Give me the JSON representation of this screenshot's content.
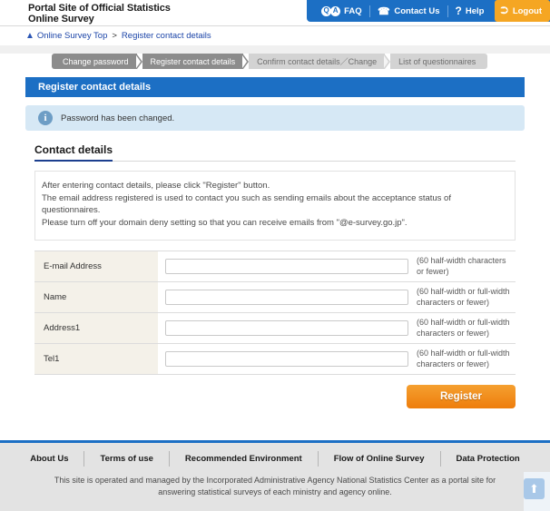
{
  "header": {
    "site_title_line1": "Portal Site of Official Statistics",
    "site_title_line2": "Online Survey",
    "nav": {
      "faq": "FAQ",
      "faq_icon_q": "Q",
      "faq_icon_a": "A",
      "contact": "Contact Us",
      "contact_icon": "phone-icon",
      "help": "Help",
      "help_icon": "?",
      "logout": "Logout",
      "logout_icon": "exit-icon"
    },
    "nav_bg_color": "#1c6fc4",
    "logout_bg_color": "#f5a623"
  },
  "breadcrumb": {
    "home_icon": "home-icon",
    "home": "Online Survey Top",
    "separator": ">",
    "current": "Register contact details"
  },
  "steps": [
    {
      "label": "Change password",
      "state": "done"
    },
    {
      "label": "Register contact details",
      "state": "current"
    },
    {
      "label": "Confirm contact details／Change",
      "state": "upcoming"
    },
    {
      "label": "List of questionnaires",
      "state": "upcoming"
    }
  ],
  "page_title": "Register contact details",
  "page_title_bg": "#1c6fc4",
  "info_message": {
    "icon": "info-icon",
    "text": "Password has been changed."
  },
  "section": {
    "heading": "Contact details",
    "underline_color": "#1c3f8f"
  },
  "notice_lines": [
    "After entering contact details, please click \"Register\" button.",
    "The email address registered is used to contact you such as sending emails about the acceptance status of questionnaires.",
    "Please turn off your domain deny setting so that you can receive emails from \"@e-survey.go.jp\"."
  ],
  "form_rows": [
    {
      "label": "E-mail Address",
      "value": "",
      "placeholder": "",
      "note": "(60 half-width characters or fewer)"
    },
    {
      "label": "Name",
      "value": "",
      "placeholder": "",
      "note": "(60 half-width or full-width characters or fewer)"
    },
    {
      "label": "Address1",
      "value": "",
      "placeholder": "",
      "note": "(60 half-width or full-width characters or fewer)"
    },
    {
      "label": "Tel1",
      "value": "",
      "placeholder": "",
      "note": "(60 half-width or full-width characters or fewer)"
    }
  ],
  "submit": {
    "label": "Register",
    "color": "#f08a1d"
  },
  "footer": {
    "links": [
      "About Us",
      "Terms of use",
      "Recommended Environment",
      "Flow of Online Survey",
      "Data Protection"
    ],
    "note": "This site is operated and managed by the Incorporated Administrative Agency National Statistics Center as a portal site for answering statistical surveys of each ministry and agency online.",
    "to_top_icon": "arrow-up-icon",
    "border_color": "#1c6fc4"
  }
}
